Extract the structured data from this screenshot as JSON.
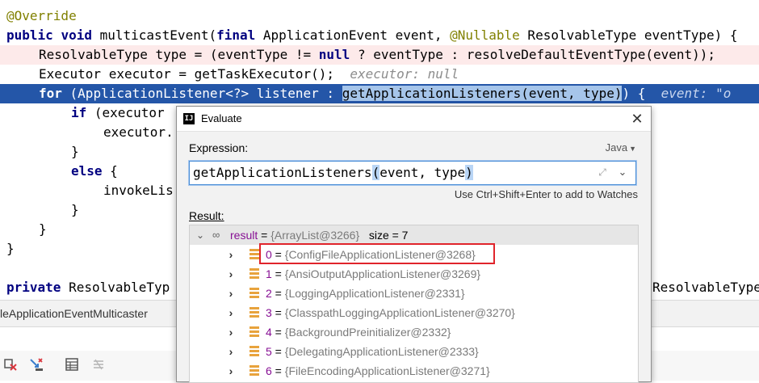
{
  "code": {
    "lines": [
      "@Override",
      "public void multicastEvent(final ApplicationEvent event, @Nullable ResolvableType eventType) {",
      "ResolvableType type = (eventType != null ? eventType : resolveDefaultEventType(event));",
      "Executor executor = getTaskExecutor();",
      "for (ApplicationListener<?> listener : getApplicationListeners(event, type)) {",
      "if (executor",
      "executor.",
      "}",
      "else {",
      "invokeLis",
      "}",
      "}",
      "}",
      "private ResolvableTyp",
      "ResolvableType"
    ],
    "inline_hints": {
      "executor": "executor: null",
      "event": "event: \"o"
    }
  },
  "file_bar": {
    "label": "leApplicationEventMulticaster"
  },
  "toolbar": {
    "icons": [
      "drop-frame-icon",
      "force-step-icon",
      "table-icon",
      "stack-icon"
    ]
  },
  "dialog": {
    "title": "Evaluate",
    "expression_label": "Expression:",
    "language": "Java",
    "expression": "getApplicationListeners(event, type)",
    "watch_hint": "Use Ctrl+Shift+Enter to add to Watches",
    "result_label": "Result:",
    "result": {
      "name": "result",
      "value": "{ArrayList@3266}",
      "size": "size = 7",
      "items": [
        {
          "index": "0",
          "value": "{ConfigFileApplicationListener@3268}"
        },
        {
          "index": "1",
          "value": "{AnsiOutputApplicationListener@3269}"
        },
        {
          "index": "2",
          "value": "{LoggingApplicationListener@2331}"
        },
        {
          "index": "3",
          "value": "{ClasspathLoggingApplicationListener@3270}"
        },
        {
          "index": "4",
          "value": "{BackgroundPreinitializer@2332}"
        },
        {
          "index": "5",
          "value": "{DelegatingApplicationListener@2333}"
        },
        {
          "index": "6",
          "value": "{FileEncodingApplicationListener@3271}"
        }
      ]
    }
  }
}
